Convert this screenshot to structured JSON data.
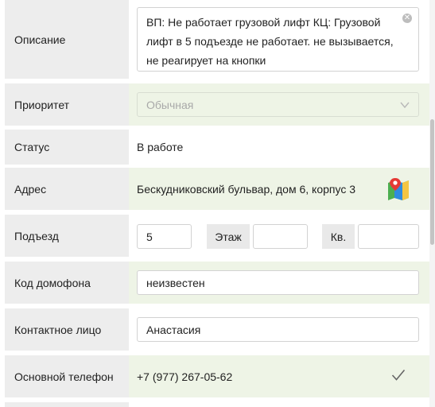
{
  "rows": {
    "description": {
      "label": "Описание",
      "value": "ВП: Не работает грузовой лифт КЦ: Грузовой лифт в 5 подъезде не работает. не вызывается, не реагирует на кнопки"
    },
    "priority": {
      "label": "Приоритет",
      "placeholder": "Обычная"
    },
    "status": {
      "label": "Статус",
      "value": "В работе"
    },
    "address": {
      "label": "Адрес",
      "value": "Бескудниковский бульвар, дом 6, корпус 3"
    },
    "entrance": {
      "label": "Подъезд",
      "value": "5",
      "floor_label": "Этаж",
      "floor_value": "",
      "apt_label": "Кв.",
      "apt_value": ""
    },
    "intercom": {
      "label": "Код домофона",
      "value": "неизвестен"
    },
    "contact": {
      "label": "Контактное лицо",
      "value": "Анастасия"
    },
    "phone": {
      "label": "Основной телефон",
      "value": "+7 (977) 267-05-62"
    }
  },
  "icons": {
    "clear": "clear-icon",
    "chevron": "chevron-down-icon",
    "map": "map-icon",
    "check": "check-icon"
  },
  "colors": {
    "label_bg": "#ededed",
    "highlight_bg": "#eef4e6",
    "input_border": "#d2d2d2"
  }
}
